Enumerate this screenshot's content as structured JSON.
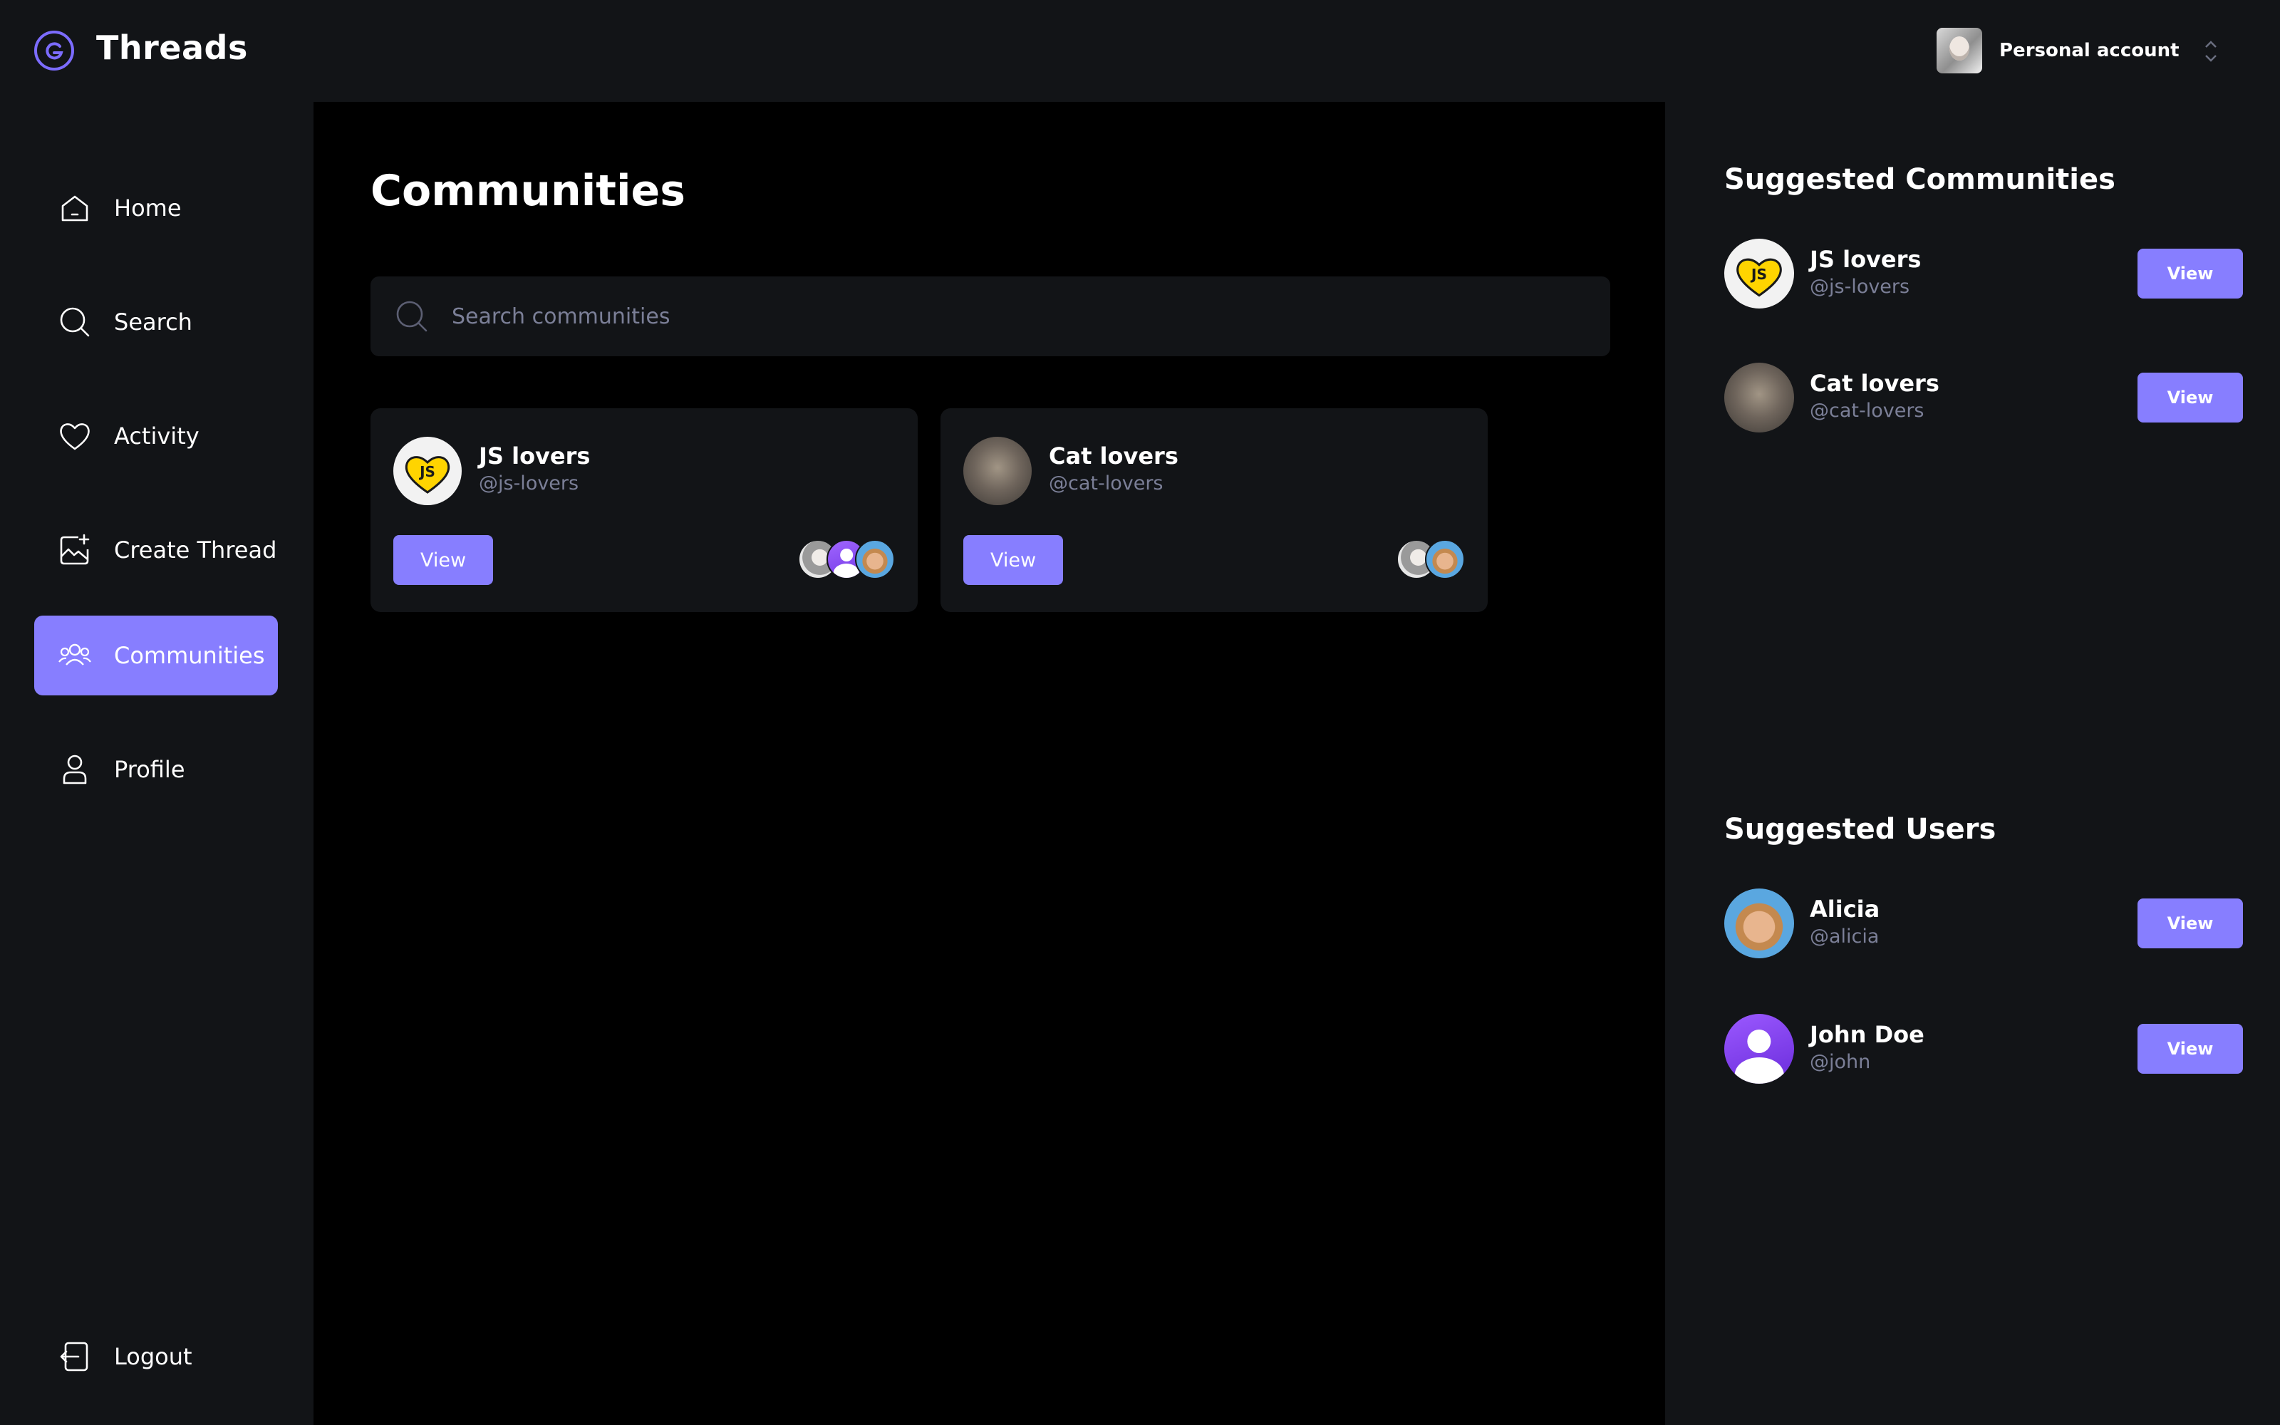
{
  "app": {
    "title": "Threads"
  },
  "account": {
    "label": "Personal account"
  },
  "nav": {
    "items": [
      {
        "label": "Home",
        "icon": "home-icon"
      },
      {
        "label": "Search",
        "icon": "search-icon"
      },
      {
        "label": "Activity",
        "icon": "heart-icon"
      },
      {
        "label": "Create Thread",
        "icon": "create-thread-icon"
      },
      {
        "label": "Communities",
        "icon": "communities-icon",
        "active": true
      },
      {
        "label": "Profile",
        "icon": "user-icon"
      }
    ],
    "logout": "Logout"
  },
  "main": {
    "title": "Communities",
    "search": {
      "placeholder": "Search communities",
      "value": ""
    },
    "communities": [
      {
        "name": "JS lovers",
        "handle": "@js-lovers",
        "button": "View",
        "avatar_text": "JS"
      },
      {
        "name": "Cat lovers",
        "handle": "@cat-lovers",
        "button": "View"
      }
    ]
  },
  "right": {
    "suggested_communities": {
      "heading": "Suggested Communities",
      "items": [
        {
          "name": "JS lovers",
          "handle": "@js-lovers",
          "button": "View",
          "avatar_text": "JS"
        },
        {
          "name": "Cat lovers",
          "handle": "@cat-lovers",
          "button": "View"
        }
      ]
    },
    "suggested_users": {
      "heading": "Suggested Users",
      "items": [
        {
          "name": "Alicia",
          "handle": "@alicia",
          "button": "View"
        },
        {
          "name": "John Doe",
          "handle": "@john",
          "button": "View"
        }
      ]
    }
  },
  "colors": {
    "accent": "#877eff",
    "panel": "#121417",
    "background": "#000000",
    "muted": "#7b7f97"
  }
}
